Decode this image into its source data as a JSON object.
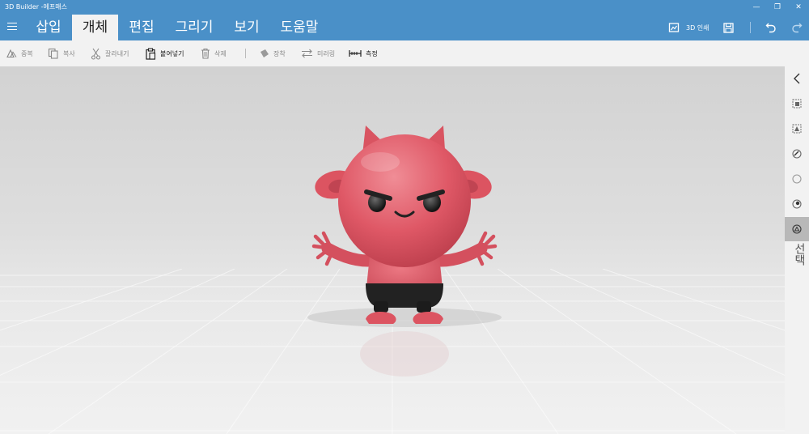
{
  "window": {
    "title": "3D Builder -에프매스",
    "minimize": "—",
    "restore": "❐",
    "close": "✕"
  },
  "menu": {
    "tabs": [
      {
        "label": "삽입"
      },
      {
        "label": "개체"
      },
      {
        "label": "편집"
      },
      {
        "label": "그리기"
      },
      {
        "label": "보기"
      },
      {
        "label": "도움말"
      }
    ],
    "active_tab": "개체",
    "print_label": "3D 인쇄"
  },
  "toolbar": {
    "items": [
      {
        "label": "중복",
        "enabled": false
      },
      {
        "label": "복사",
        "enabled": false
      },
      {
        "label": "잘라내기",
        "enabled": false
      },
      {
        "label": "붙여넣기",
        "enabled": true
      },
      {
        "label": "삭제",
        "enabled": false
      },
      {
        "label": "장착",
        "enabled": false
      },
      {
        "label": "미러링",
        "enabled": false
      },
      {
        "label": "측정",
        "enabled": true
      }
    ]
  },
  "side_panel": {
    "label": "선택",
    "buttons": [
      "collapse-panel",
      "select-objects",
      "select-faces",
      "select-edges",
      "select-vertices",
      "select-regions",
      "select-mode"
    ]
  },
  "colors": {
    "header": "#4a90c8",
    "toolbar": "#f2f2f2",
    "model_body": "#df5866",
    "model_shorts": "#222222"
  },
  "scene": {
    "model": "red devil character"
  }
}
